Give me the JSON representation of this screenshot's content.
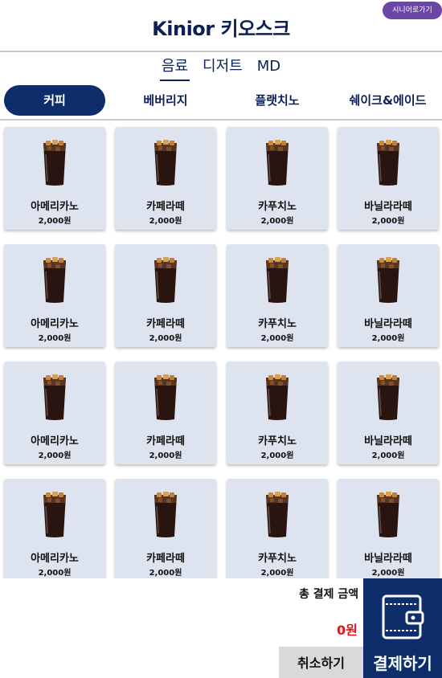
{
  "header": {
    "title": "Kinior 키오스크",
    "senior_button": "시니어로가기"
  },
  "top_tabs": [
    {
      "label": "음료",
      "active": true
    },
    {
      "label": "디저트",
      "active": false
    },
    {
      "label": "MD",
      "active": false
    }
  ],
  "categories": [
    {
      "label": "커피",
      "active": true
    },
    {
      "label": "베버리지",
      "active": false
    },
    {
      "label": "플랫치노",
      "active": false
    },
    {
      "label": "쉐이크&에이드",
      "active": false
    }
  ],
  "menu_items": [
    {
      "name": "아메리카노",
      "price": "2,000원"
    },
    {
      "name": "카페라떼",
      "price": "2,000원"
    },
    {
      "name": "카푸치노",
      "price": "2,000원"
    },
    {
      "name": "바닐라라떼",
      "price": "2,000원"
    },
    {
      "name": "아메리카노",
      "price": "2,000원"
    },
    {
      "name": "카페라떼",
      "price": "2,000원"
    },
    {
      "name": "카푸치노",
      "price": "2,000원"
    },
    {
      "name": "바닐라라떼",
      "price": "2,000원"
    },
    {
      "name": "아메리카노",
      "price": "2,000원"
    },
    {
      "name": "카페라떼",
      "price": "2,000원"
    },
    {
      "name": "카푸치노",
      "price": "2,000원"
    },
    {
      "name": "바닐라라떼",
      "price": "2,000원"
    },
    {
      "name": "아메리카노",
      "price": "2,000원"
    },
    {
      "name": "카페라떼",
      "price": "2,000원"
    },
    {
      "name": "카푸치노",
      "price": "2,000원"
    },
    {
      "name": "바닐라라떼",
      "price": "2,000원"
    }
  ],
  "item_icon": "iced-coffee-icon",
  "footer": {
    "total_label": "총 결제 금액",
    "total_value": "0원",
    "cancel_label": "취소하기",
    "pay_label": "결제하기",
    "pay_icon": "wallet-icon"
  },
  "colors": {
    "primary": "#0d2d6b",
    "title": "#0d1f57",
    "senior": "#6b46a6",
    "card_bg": "#dde4ef",
    "total_value": "#e8141b",
    "cancel_bg": "#d9d9d9"
  }
}
